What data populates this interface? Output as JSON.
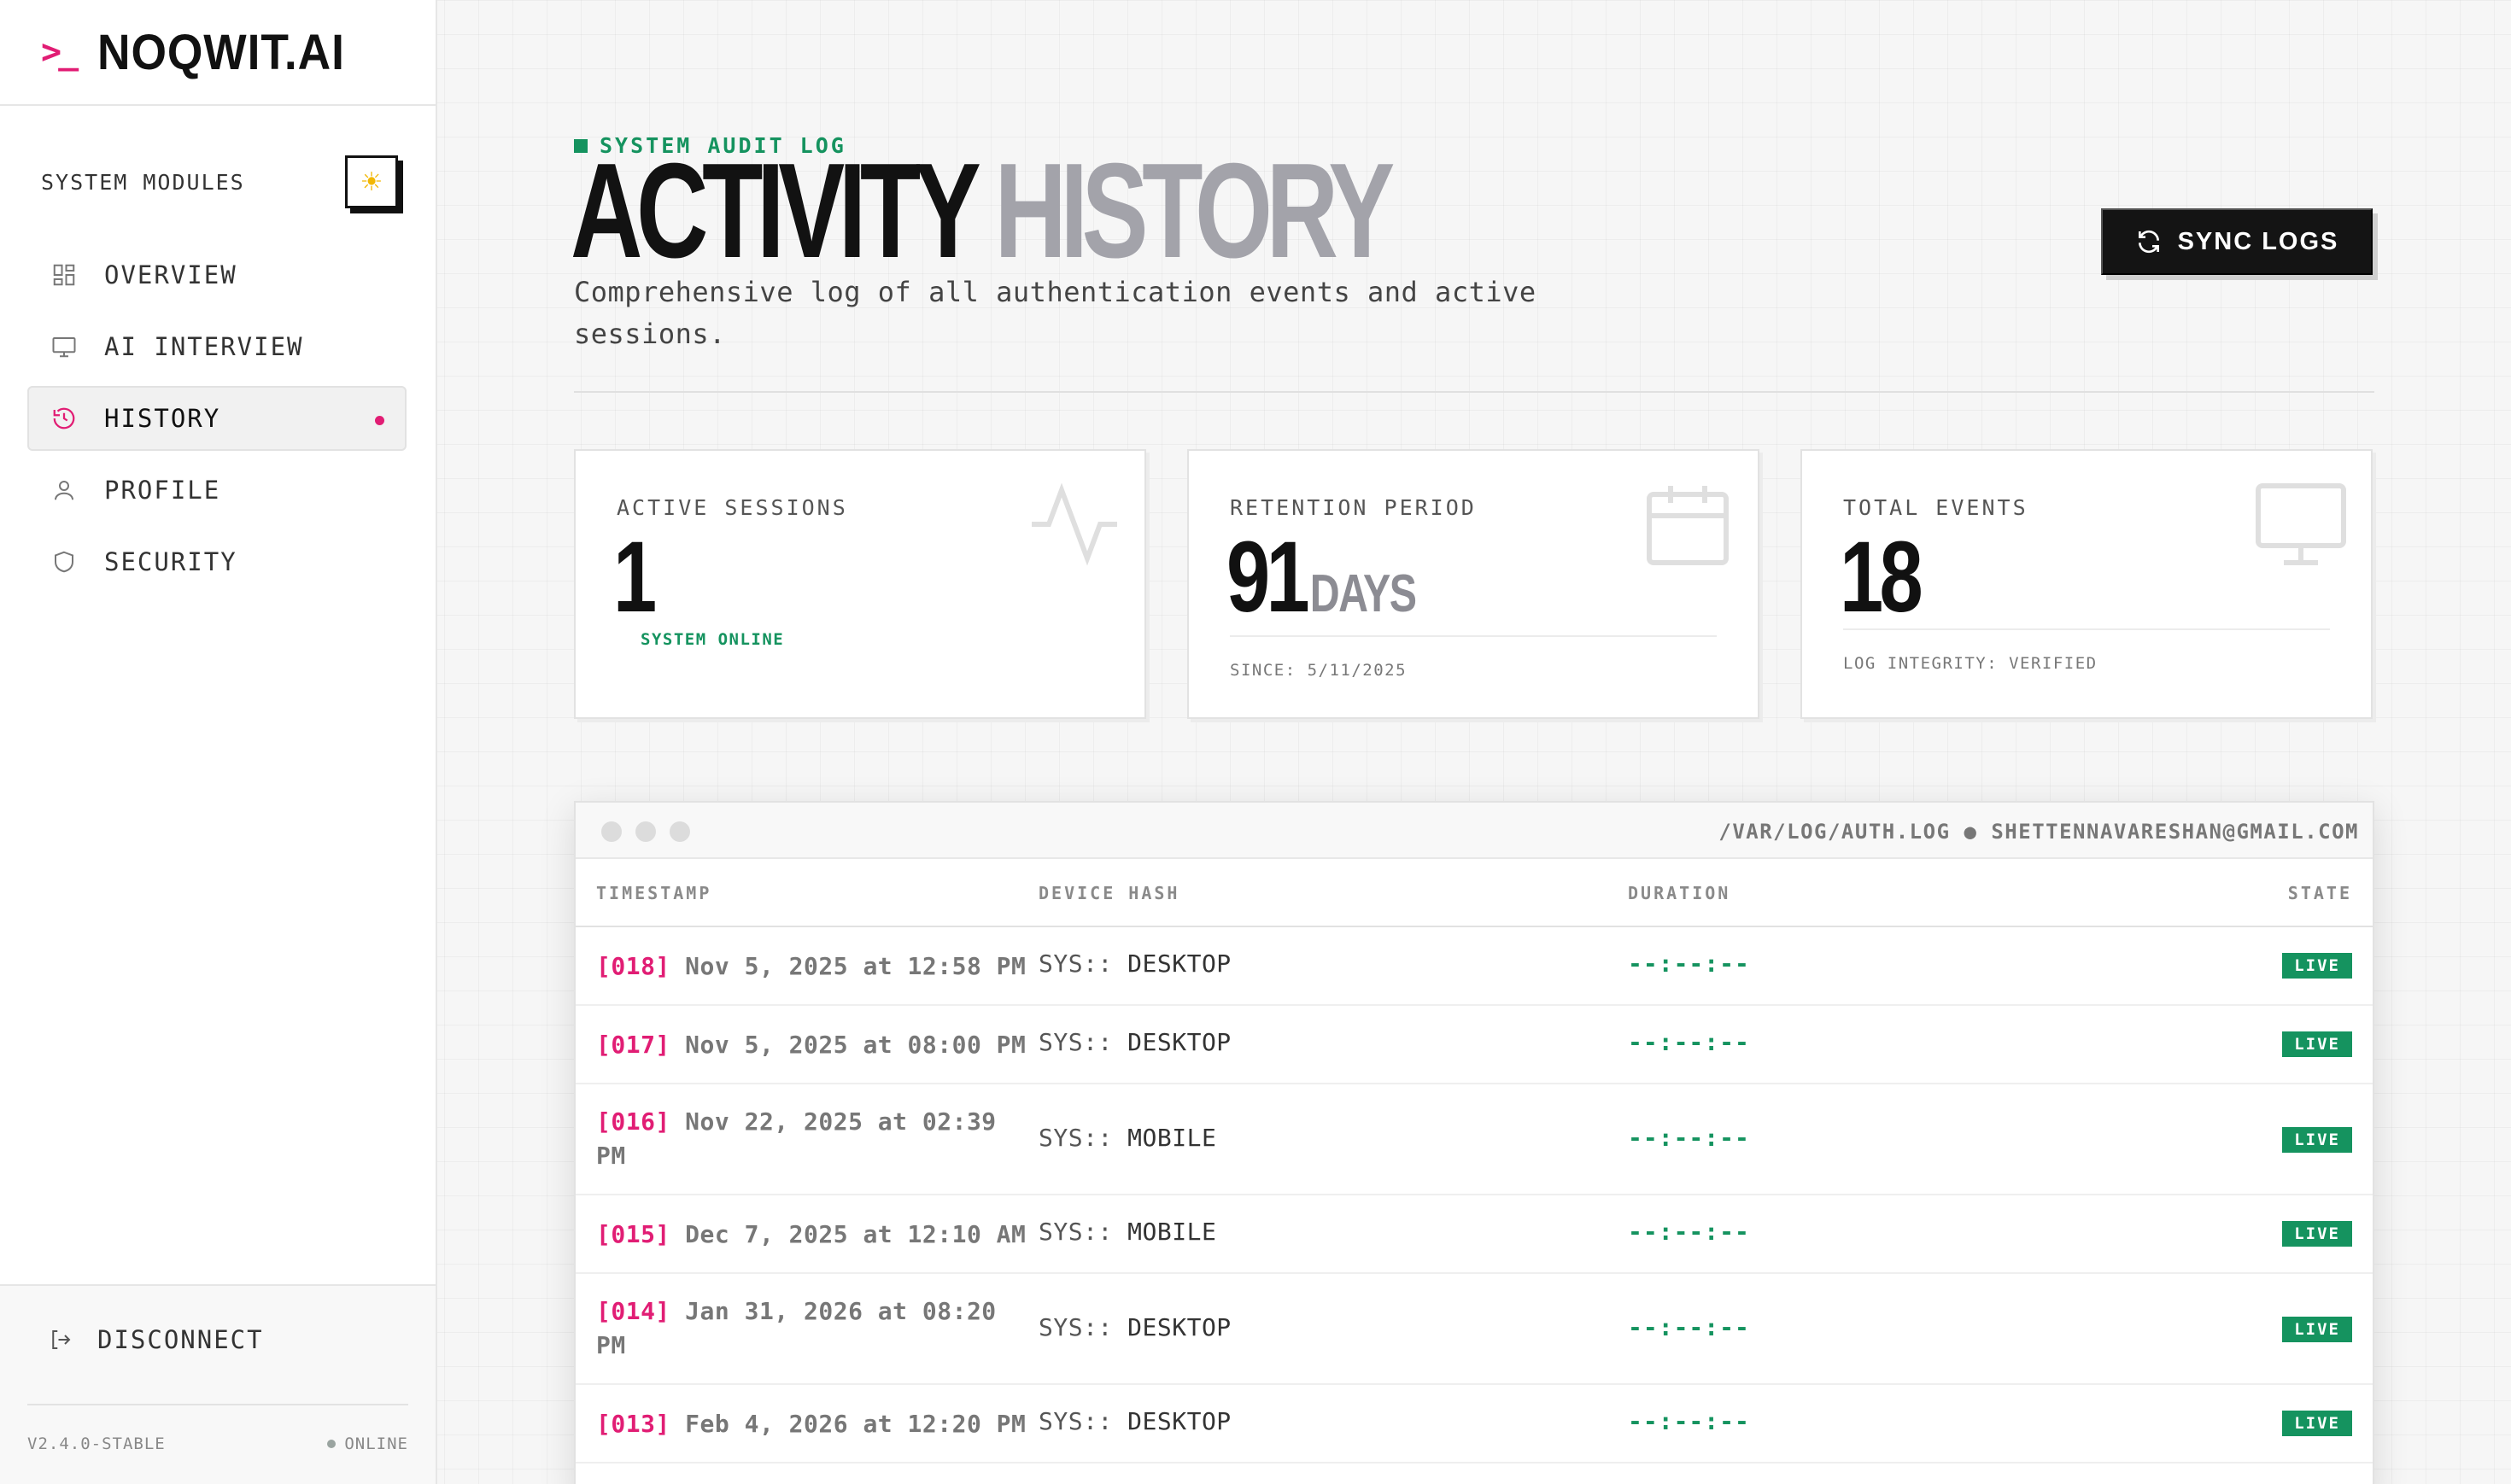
{
  "brand": {
    "prompt": ">_",
    "name": "NOQWIT.AI"
  },
  "sidebar": {
    "modules_label": "SYSTEM MODULES",
    "theme_icon": "sun-icon",
    "items": [
      {
        "label": "OVERVIEW",
        "icon": "grid-icon",
        "active": false
      },
      {
        "label": "AI INTERVIEW",
        "icon": "monitor-icon",
        "active": false
      },
      {
        "label": "HISTORY",
        "icon": "history-icon",
        "active": true
      },
      {
        "label": "PROFILE",
        "icon": "user-icon",
        "active": false
      },
      {
        "label": "SECURITY",
        "icon": "shield-icon",
        "active": false
      }
    ],
    "disconnect_label": "DISCONNECT",
    "version": "V2.4.0-STABLE",
    "status": "ONLINE"
  },
  "header": {
    "eyebrow": "SYSTEM AUDIT LOG",
    "title_primary": "ACTIVITY",
    "title_secondary": "HISTORY",
    "subtitle": "Comprehensive log of all authentication events and active sessions.",
    "sync_label": "SYNC LOGS"
  },
  "stats": {
    "sessions": {
      "label": "ACTIVE SESSIONS",
      "value": "1",
      "footer": "SYSTEM ONLINE"
    },
    "retention": {
      "label": "RETENTION PERIOD",
      "value": "91",
      "unit": "DAYS",
      "footer": "SINCE: 5/11/2025"
    },
    "events": {
      "label": "TOTAL EVENTS",
      "value": "18",
      "footer": "LOG INTEGRITY: VERIFIED"
    }
  },
  "log": {
    "path": "/VAR/LOG/AUTH.LOG ● SHETTENNAVARESHAN@GMAIL.COM",
    "columns": {
      "timestamp": "TIMESTAMP",
      "device": "DEVICE HASH",
      "duration": "DURATION",
      "state": "STATE"
    },
    "rows": [
      {
        "index": "[018]",
        "time": "Nov 5, 2025 at 12:58 PM",
        "device_prefix": "SYS::",
        "device": "DESKTOP",
        "duration": "--:--:--",
        "state": "LIVE"
      },
      {
        "index": "[017]",
        "time": "Nov 5, 2025 at 08:00 PM",
        "device_prefix": "SYS::",
        "device": "DESKTOP",
        "duration": "--:--:--",
        "state": "LIVE"
      },
      {
        "index": "[016]",
        "time": "Nov 22, 2025 at 02:39 PM",
        "device_prefix": "SYS::",
        "device": "MOBILE",
        "duration": "--:--:--",
        "state": "LIVE"
      },
      {
        "index": "[015]",
        "time": "Dec 7, 2025 at 12:10 AM",
        "device_prefix": "SYS::",
        "device": "MOBILE",
        "duration": "--:--:--",
        "state": "LIVE"
      },
      {
        "index": "[014]",
        "time": "Jan 31, 2026 at 08:20 PM",
        "device_prefix": "SYS::",
        "device": "DESKTOP",
        "duration": "--:--:--",
        "state": "LIVE"
      },
      {
        "index": "[013]",
        "time": "Feb 4, 2026 at 12:20 PM",
        "device_prefix": "SYS::",
        "device": "DESKTOP",
        "duration": "--:--:--",
        "state": "LIVE"
      }
    ]
  },
  "colors": {
    "accent": "#e11d74",
    "success": "#15935f",
    "dark": "#141414"
  }
}
